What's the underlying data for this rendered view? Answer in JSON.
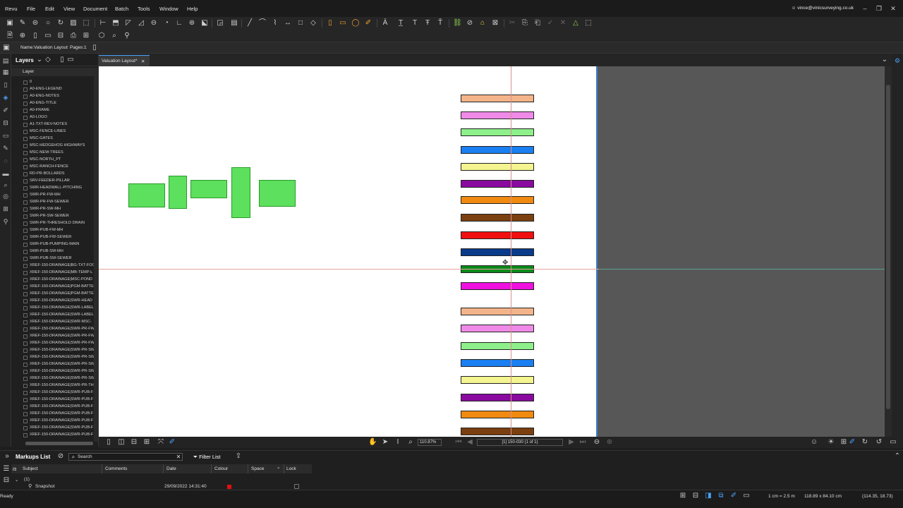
{
  "menubar": {
    "items": [
      "Revu",
      "File",
      "Edit",
      "View",
      "Document",
      "Batch",
      "Tools",
      "Window",
      "Help"
    ],
    "account": "vince@vinicsurveying.co.uk"
  },
  "propbar": {
    "name_label": "Name:",
    "name_value": "Valuation Layout",
    "pages_label": "Pages:",
    "pages_value": "1"
  },
  "layers": {
    "title": "Layers",
    "column": "Layer",
    "items": [
      "0",
      "A0-ENG-LEGEND",
      "A0-ENG-NOTES",
      "A0-ENG-TITLE",
      "A0-FRAME",
      "A0-LOGO",
      "A1-TXT-REV-NOTES",
      "MSC-FENCE-LINES",
      "MSC-GATES",
      "MSC-HEDGEHOG HIGHWAYS",
      "MSC-NEW-TREES",
      "MSC-NORTH_PT",
      "MSC-RANCH-FENCE",
      "RD-PR-BOLLARDS",
      "SRV-FEEDER-PILLAR",
      "SWR-HEADWALL-PITCHING",
      "SWR-PR-FW-MH",
      "SWR-PR-FW-SEWER",
      "SWR-PR-SW-MH",
      "SWR-PR-SW-SEWER",
      "SWR-PR-THRESHOLD DRAIN",
      "SWR-PUB-FW-MH",
      "SWR-PUB-FW-SEWER",
      "SWR-PUB-PUMPING-MAIN",
      "SWR-PUB-SW-MH",
      "SWR-PUB-SW-SEWER",
      "XREF-150-DRAINAGE|BG-TXT-FOO",
      "XREF-150-DRAINAGE|MB-TEMP-L",
      "XREF-150-DRAINAGE|MSC-POND",
      "XREF-150-DRAINAGE|PGM-BATTE",
      "XREF-150-DRAINAGE|PGM-BATTE",
      "XREF-150-DRAINAGE|SWR-HEAD",
      "XREF-150-DRAINAGE|SWR-LABEL",
      "XREF-150-DRAINAGE|SWR-LABEL",
      "XREF-150-DRAINAGE|SWR-MSC-",
      "XREF-150-DRAINAGE|SWR-PR-FW",
      "XREF-150-DRAINAGE|SWR-PR-FW",
      "XREF-150-DRAINAGE|SWR-PR-FW",
      "XREF-150-DRAINAGE|SWR-PR-SW",
      "XREF-150-DRAINAGE|SWR-PR-SW",
      "XREF-150-DRAINAGE|SWR-PR-SW",
      "XREF-150-DRAINAGE|SWR-PR-SW",
      "XREF-150-DRAINAGE|SWR-PR-SW",
      "XREF-150-DRAINAGE|SWR-PR-TH",
      "XREF-150-DRAINAGE|SWR-PUB-F",
      "XREF-150-DRAINAGE|SWR-PUB-F",
      "XREF-150-DRAINAGE|SWR-PUB-F",
      "XREF-150-DRAINAGE|SWR-PUB-F",
      "XREF-150-DRAINAGE|SWR-PUB-F",
      "XREF-150-DRAINAGE|SWR-PUB-F",
      "XREF-150-DRAINAGE|SWR-PUB-F"
    ]
  },
  "doc_tab": {
    "label": "Valuation Layout*"
  },
  "legend_bars": [
    {
      "color": "#f4b48a"
    },
    {
      "color": "#f08ae8"
    },
    {
      "color": "#8ef08a"
    },
    {
      "color": "#1a7ff0"
    },
    {
      "color": "#f4f490"
    },
    {
      "color": "#8a0aa0"
    },
    {
      "color": "#f08a10"
    },
    {
      "color": "#7a4010"
    },
    {
      "color": "#f01010"
    },
    {
      "color": "#0a3a8a"
    },
    {
      "color": "#0a8a1a"
    },
    {
      "color": "#f010e0"
    },
    {
      "color": "#f4b48a"
    },
    {
      "color": "#f08ae8"
    },
    {
      "color": "#8ef08a"
    },
    {
      "color": "#1a7ff0"
    },
    {
      "color": "#f4f490"
    },
    {
      "color": "#8a0aa0"
    },
    {
      "color": "#f08a10"
    },
    {
      "color": "#7a4010"
    }
  ],
  "navbar": {
    "zoom": "110.87%",
    "page": "[1] 150-030 (1 of 1)"
  },
  "markups": {
    "title": "Markups List",
    "search_placeholder": "Search",
    "filter": "Filter List",
    "columns": [
      "Subject",
      "Comments",
      "Date",
      "Colour",
      "Space",
      "Lock"
    ],
    "group": "(1)",
    "row": {
      "subject": "Snapshot",
      "date": "29/09/2022 14:31:40",
      "colour": "#e01010"
    }
  },
  "statusbar": {
    "status": "Ready",
    "scale": "1 cm = 2.5 m",
    "size": "118.89 x 84.10 cm",
    "coords": "(114.35, 18.73)"
  }
}
